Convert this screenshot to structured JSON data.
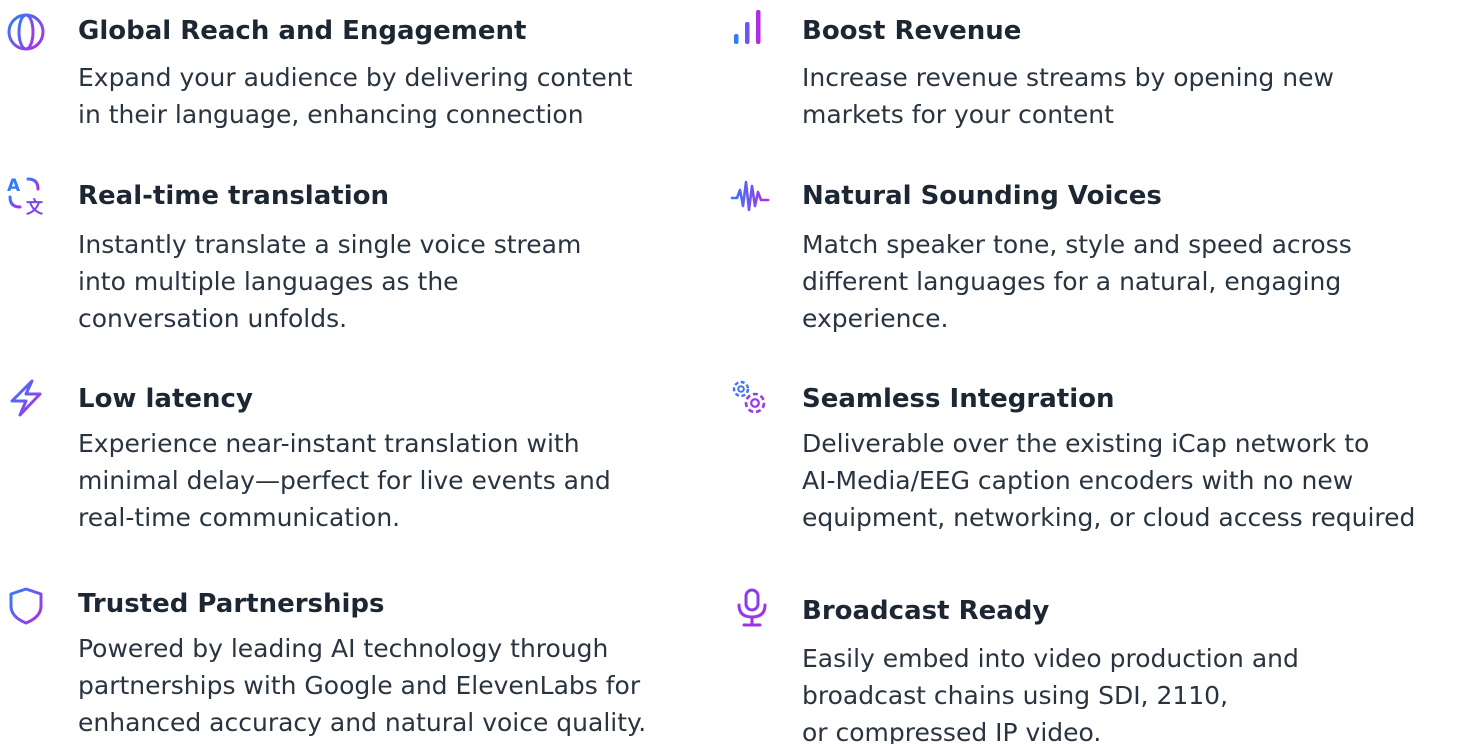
{
  "features": [
    {
      "title": "Global Reach and Engagement",
      "icon": "globe-icon",
      "lines": [
        "Expand your audience by delivering content",
        "in their language, enhancing connection"
      ]
    },
    {
      "title": "Boost Revenue",
      "icon": "bar-chart-icon",
      "lines": [
        "Increase revenue streams by opening new",
        "markets for your content"
      ]
    },
    {
      "title": "Real-time translation",
      "icon": "translate-icon",
      "lines": [
        "Instantly translate a single voice stream",
        "into multiple languages as the",
        "conversation unfolds."
      ]
    },
    {
      "title": "Natural Sounding Voices",
      "icon": "soundwave-icon",
      "lines": [
        "Match speaker tone, style and speed across",
        "different languages for a natural, engaging",
        "experience."
      ]
    },
    {
      "title": "Low latency",
      "icon": "lightning-icon",
      "lines": [
        "Experience near-instant translation with",
        "minimal delay—perfect for live events and",
        "real-time communication."
      ]
    },
    {
      "title": "Seamless Integration",
      "icon": "gears-icon",
      "lines": [
        "Deliverable over the existing iCap network to",
        "AI-Media/EEG caption encoders with no new",
        "equipment, networking, or cloud access required"
      ]
    },
    {
      "title": "Trusted Partnerships",
      "icon": "shield-icon",
      "lines": [
        "Powered by leading AI technology through",
        "partnerships with Google and ElevenLabs for",
        "enhanced accuracy and natural voice quality."
      ]
    },
    {
      "title": "Broadcast Ready",
      "icon": "microphone-icon",
      "lines": [
        "Easily embed into video production and",
        "broadcast chains using SDI, 2110,",
        "or compressed IP video."
      ]
    }
  ],
  "colors": {
    "gradient_start": "#2f7dfa",
    "gradient_end": "#b12de3",
    "text": "#1d2733"
  }
}
